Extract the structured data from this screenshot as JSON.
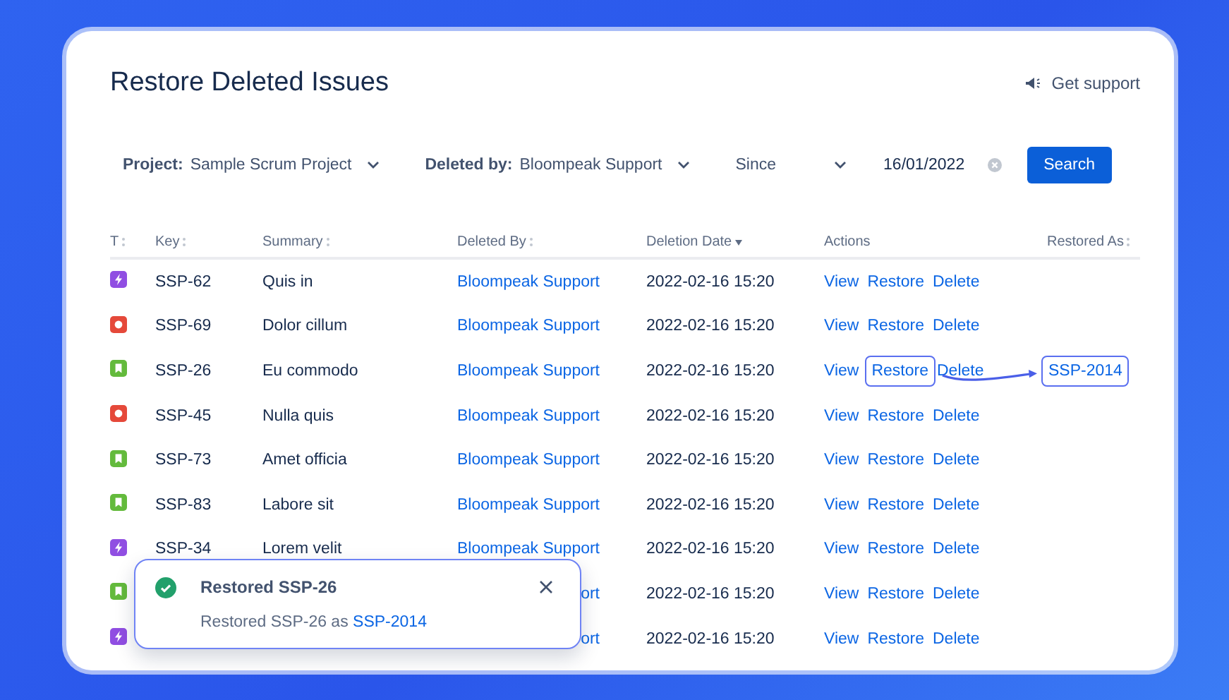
{
  "title": "Restore Deleted Issues",
  "support_link": "Get support",
  "filters": [
    {
      "kind": "select",
      "label": "Project:",
      "value": "Sample Scrum Project"
    },
    {
      "kind": "select",
      "label": "Deleted by:",
      "value": "Bloompeak Support"
    },
    {
      "kind": "select",
      "value": "Since"
    },
    {
      "kind": "date",
      "value": "16/01/2022"
    }
  ],
  "search_button": "Search",
  "table": {
    "columns": [
      {
        "label": "T",
        "sortable": true
      },
      {
        "label": "Key",
        "sortable": true
      },
      {
        "label": "Summary",
        "sortable": true
      },
      {
        "label": "Deleted By",
        "sortable": true
      },
      {
        "label": "Deletion Date",
        "sortable": true,
        "sorted_descending": true
      },
      {
        "label": "Actions",
        "sortable": false
      },
      {
        "label": "Restored As",
        "sortable": true
      }
    ],
    "rows": [
      {
        "kind": "epic",
        "key": "SSP-62",
        "summary": "Quis in",
        "deleted_by": "Bloompeak Support",
        "date": "2022-02-16 15:20",
        "actions": [
          "View",
          "Restore",
          "Delete"
        ],
        "highlighted": false
      },
      {
        "kind": "bug",
        "key": "SSP-69",
        "summary": "Dolor cillum",
        "deleted_by": "Bloompeak Support",
        "date": "2022-02-16 15:20",
        "actions": [
          "View",
          "Restore",
          "Delete"
        ],
        "highlighted": false
      },
      {
        "kind": "story",
        "key": "SSP-26",
        "summary": "Eu commodo",
        "deleted_by": "Bloompeak Support",
        "date": "2022-02-16 15:20",
        "actions": [
          "View",
          "Restore",
          "Delete"
        ],
        "highlighted": true,
        "restored_as": "SSP-2014"
      },
      {
        "kind": "bug",
        "key": "SSP-45",
        "summary": "Nulla quis",
        "deleted_by": "Bloompeak Support",
        "date": "2022-02-16 15:20",
        "actions": [
          "View",
          "Restore",
          "Delete"
        ],
        "highlighted": false
      },
      {
        "kind": "story",
        "key": "SSP-73",
        "summary": "Amet officia",
        "deleted_by": "Bloompeak Support",
        "date": "2022-02-16 15:20",
        "actions": [
          "View",
          "Restore",
          "Delete"
        ],
        "highlighted": false
      },
      {
        "kind": "story",
        "key": "SSP-83",
        "summary": "Labore sit",
        "deleted_by": "Bloompeak Support",
        "date": "2022-02-16 15:20",
        "actions": [
          "View",
          "Restore",
          "Delete"
        ],
        "highlighted": false
      },
      {
        "kind": "epic",
        "key": "SSP-34",
        "summary": "Lorem velit",
        "deleted_by": "Bloompeak Support",
        "date": "2022-02-16 15:20",
        "actions": [
          "View",
          "Restore",
          "Delete"
        ],
        "highlighted": false
      },
      {
        "kind": "story",
        "deleted_by": "ort",
        "clipped": true,
        "date": "2022-02-16 15:20",
        "actions": [
          "View",
          "Restore",
          "Delete"
        ],
        "highlighted": false
      },
      {
        "kind": "epic",
        "deleted_by": "ort",
        "clipped": true,
        "date": "2022-02-16 15:20",
        "actions": [
          "View",
          "Restore",
          "Delete"
        ],
        "highlighted": false
      }
    ]
  },
  "toast": {
    "title": "Restored SSP-26",
    "message_prefix": "Restored SSP-26 as",
    "link": "SSP-2014"
  }
}
